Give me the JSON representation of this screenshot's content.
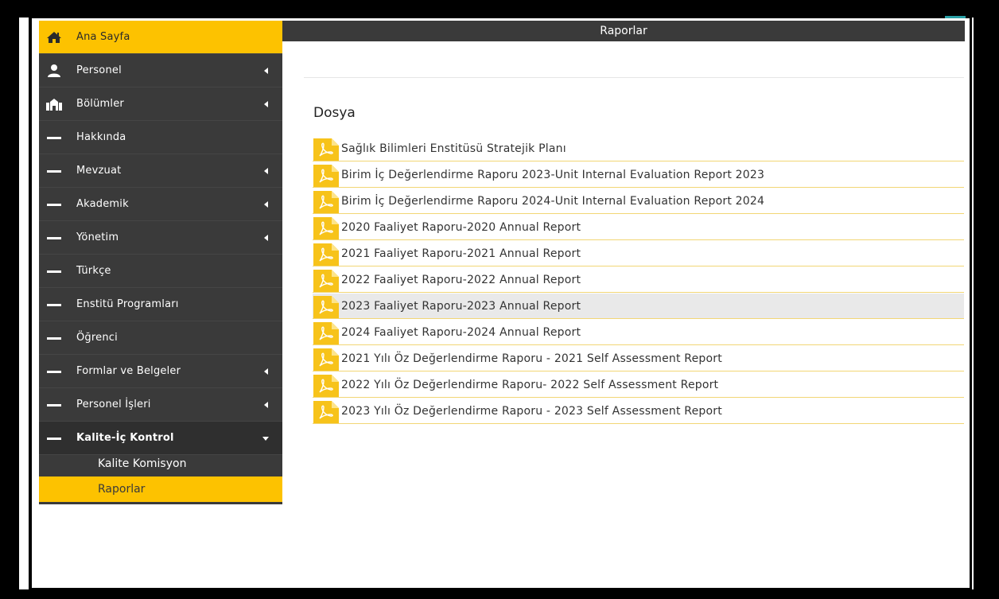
{
  "header": {
    "title": "Raporlar"
  },
  "sidebar": {
    "items": [
      {
        "label": "Ana Sayfa",
        "icon": "home-icon"
      },
      {
        "label": "Personel",
        "icon": "person-icon"
      },
      {
        "label": "Bölümler",
        "icon": "building-icon"
      },
      {
        "label": "Hakkında",
        "icon": "dash-icon"
      },
      {
        "label": "Mevzuat",
        "icon": "dash-icon"
      },
      {
        "label": "Akademik",
        "icon": "dash-icon"
      },
      {
        "label": "Yönetim",
        "icon": "dash-icon"
      },
      {
        "label": "Türkçe",
        "icon": "dash-icon"
      },
      {
        "label": "Enstitü Programları",
        "icon": "dash-icon"
      },
      {
        "label": "Öğrenci",
        "icon": "dash-icon"
      },
      {
        "label": "Formlar ve Belgeler",
        "icon": "dash-icon"
      },
      {
        "label": "Personel İşleri",
        "icon": "dash-icon"
      },
      {
        "label": "Kalite-İç Kontrol",
        "icon": "dash-icon"
      }
    ],
    "sub_items": [
      {
        "label": "Kalite Komisyon"
      },
      {
        "label": "Raporlar"
      }
    ]
  },
  "main": {
    "section_title": "Dosya",
    "files": [
      {
        "label": "Sağlık Bilimleri Enstitüsü Stratejik Planı"
      },
      {
        "label": "Birim İç Değerlendirme Raporu 2023-Unit Internal Evaluation Report 2023"
      },
      {
        "label": "Birim İç Değerlendirme Raporu 2024-Unit Internal Evaluation Report 2024"
      },
      {
        "label": "2020 Faaliyet Raporu-2020 Annual Report"
      },
      {
        "label": "2021 Faaliyet Raporu-2021 Annual Report"
      },
      {
        "label": "2022 Faaliyet Raporu-2022 Annual Report"
      },
      {
        "label": "2023 Faaliyet Raporu-2023 Annual Report"
      },
      {
        "label": "2024 Faaliyet Raporu-2024 Annual Report"
      },
      {
        "label": "2021 Yılı Öz Değerlendirme Raporu - 2021 Self Assessment Report"
      },
      {
        "label": "2022 Yılı Öz Değerlendirme Raporu- 2022 Self Assessment Report"
      },
      {
        "label": "2023 Yılı Öz Değerlendirme Raporu - 2023 Self Assessment Report"
      }
    ]
  },
  "colors": {
    "accent": "#fdc200",
    "sidebar_bg": "#3a3a3a",
    "pdf_icon": "#f7c31a"
  }
}
